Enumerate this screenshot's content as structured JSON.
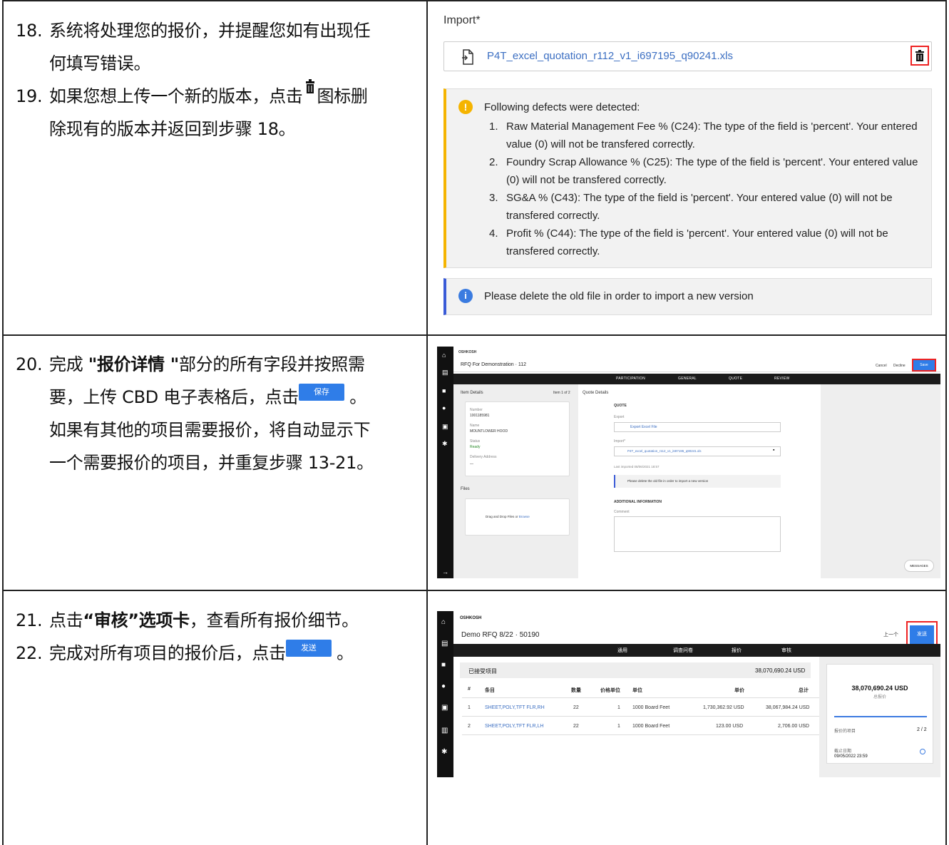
{
  "steps": {
    "s18_num": "18.",
    "s18_line1": "系统将处理您的报价，并提醒您如有出现任",
    "s18_line2": "何填写错误。",
    "s19_num": "19.",
    "s19_pre": "如果您想上传一个新的版本，点击",
    "s19_post": "图标删",
    "s19_line2": "除现有的版本并返回到步骤 18。",
    "s20_num": "20.",
    "s20_pre": "完成 ",
    "s20_bold": "\"报价详情 \"",
    "s20_post": "部分的所有字段并按照需",
    "s20_line2_pre": "要，上传 CBD 电子表格后，点击",
    "s20_btn": "保存",
    "s20_line2_post": " 。",
    "s20_line3": "如果有其他的项目需要报价，将自动显示下",
    "s20_line4": "一个需要报价的项目，并重复步骤 13-21。",
    "s21_num": "21.",
    "s21_pre": "点击",
    "s21_bold": "“审核”选项卡",
    "s21_post": "，查看所有报价细节。",
    "s22_num": "22.",
    "s22_pre": "完成对所有项目的报价后，点击",
    "s22_btn": "发送",
    "s22_post": " 。"
  },
  "shot1": {
    "import_label": "Import*",
    "file_name": "P4T_excel_quotation_r112_v1_i697195_q90241.xls",
    "warn_head": "Following defects were detected:",
    "defects": [
      {
        "n": "1.",
        "l1": "Raw Material Management Fee % (C24): The type of the field is 'percent'. Your entered",
        "l2": "value (0) will not be transfered correctly."
      },
      {
        "n": "2.",
        "l1": "Foundry Scrap Allowance % (C25): The type of the field is 'percent'. Your entered value",
        "l2": "(0) will not be transfered correctly."
      },
      {
        "n": "3.",
        "l1": "SG&A % (C43): The type of the field is 'percent'. Your entered value (0) will not be",
        "l2": "transfered correctly."
      },
      {
        "n": "4.",
        "l1": "Profit % (C44): The type of the field is 'percent'. Your entered value (0) will not be",
        "l2": "transfered correctly."
      }
    ],
    "info_text": "Please delete the old file in order to import a new version"
  },
  "shot2": {
    "brand": "OSHKOSH",
    "rfq_title": "RFQ For Demonstration · 112",
    "btn_cancel": "Cancel",
    "btn_decline": "Decline",
    "btn_save": "Save",
    "tabs": [
      "PARTICIPATION",
      "GENERAL",
      "QUOTE",
      "REVIEW"
    ],
    "item_details": "Item Details",
    "item_count": "Item 1 of 2",
    "quote_details": "Quote Details",
    "number_label": "Number",
    "number_value": "1001185981",
    "name_label": "Name",
    "name_value": "MOUNTLOWER HOOD",
    "status_label": "Status",
    "status_value": "Ready",
    "delivery_label": "Delivery Address",
    "delivery_value": "—",
    "files_label": "Files",
    "drag_text": "Drag and Drop Files or",
    "browse": "Browse",
    "quote_section": "QUOTE",
    "export_label": "Export",
    "export_file": "Export Excel File",
    "import_label": "Import*",
    "import_file": "P4T_excel_quotation_r112_v1_i697195_q90241.xls",
    "last_imported": "Last imported 08/06/2021 18:57",
    "info_text": "Please delete the old file in order to import a new version",
    "additional": "ADDITIONAL INFORMATION",
    "comment": "Comment",
    "messages": "MESSAGES"
  },
  "shot3": {
    "brand": "OSHKOSH",
    "rfq_title": "Demo RFQ 8/22 · 50190",
    "btn_prev": "上一个",
    "btn_send": "发送",
    "tabs": [
      "通用",
      "调查问卷",
      "报价",
      "审核"
    ],
    "accepted": "已接受项目",
    "accepted_total": "38,070,690.24 USD",
    "headers": [
      "#",
      "条目",
      "数量",
      "价格单位",
      "单位",
      "单价",
      "总计"
    ],
    "rows": [
      [
        "1",
        "SHEET,POLY,TFT FLR,RH",
        "22",
        "1",
        "1000 Board Feet",
        "1,730,362.92 USD",
        "38,067,984.24 USD"
      ],
      [
        "2",
        "SHEET,POLY,TFT FLR,LH",
        "22",
        "1",
        "1000 Board Feet",
        "123.00 USD",
        "2,706.00 USD"
      ]
    ],
    "side_total": "38,070,690.24 USD",
    "side_total_label": "总报价",
    "quoted_items": "报价的项目",
    "quoted_count": "2 / 2",
    "deadline_label": "截止日期",
    "deadline_value": "09/05/2022 23:59"
  }
}
